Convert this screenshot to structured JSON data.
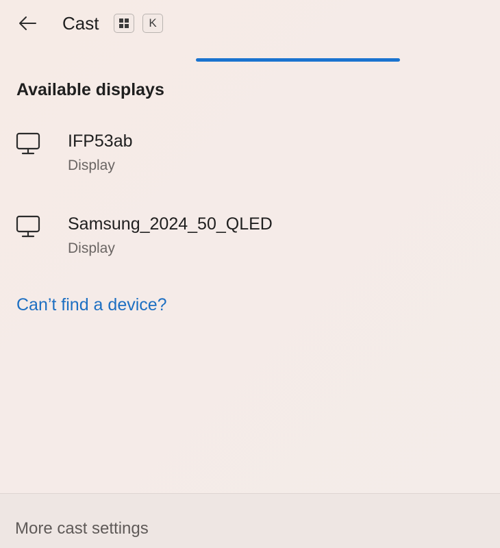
{
  "header": {
    "title": "Cast",
    "shortcut_key": "K"
  },
  "section_title": "Available displays",
  "devices": [
    {
      "name": "IFP53ab",
      "type": "Display"
    },
    {
      "name": "Samsung_2024_50_QLED",
      "type": "Display"
    }
  ],
  "help_link": "Can’t find a device?",
  "footer": {
    "settings_link": "More cast settings"
  },
  "colors": {
    "accent": "#1a73cf",
    "link": "#1d6fc2"
  },
  "icons": {
    "back": "back-arrow-icon",
    "windows_key": "windows-logo-icon",
    "device": "monitor-icon"
  }
}
